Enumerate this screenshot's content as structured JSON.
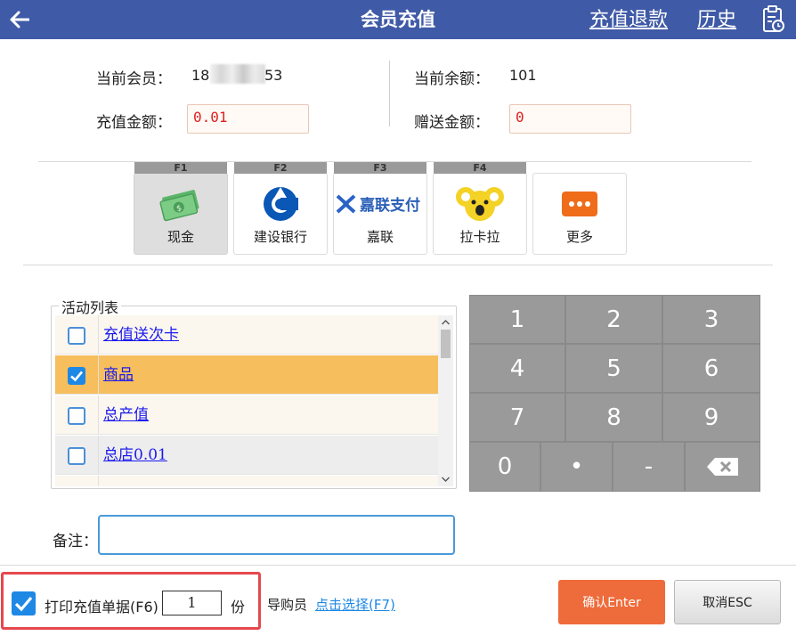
{
  "header": {
    "title": "会员充值",
    "refund_link": "充值退款",
    "history_link": "历史",
    "bg_color": "#3f5aa6"
  },
  "member": {
    "current_member_label": "当前会员：",
    "phone_prefix": "18",
    "phone_suffix": "53",
    "balance_label": "当前余额：",
    "balance_value": "101",
    "recharge_label": "充值金额：",
    "recharge_value": "0.01",
    "gift_label": "赠送金额：",
    "gift_value": "0"
  },
  "payments": [
    {
      "key": "F1",
      "label": "现金",
      "icon": "cash-icon",
      "active": true
    },
    {
      "key": "F2",
      "label": "建设银行",
      "icon": "ccb-logo-icon",
      "active": false
    },
    {
      "key": "F3",
      "label": "嘉联",
      "icon": "jialian-pay-logo-icon",
      "logo_text": "嘉联支付",
      "active": false
    },
    {
      "key": "F4",
      "label": "拉卡拉",
      "icon": "lakala-koala-icon",
      "active": false
    },
    {
      "key": "",
      "label": "更多",
      "icon": "more-icon",
      "active": false
    }
  ],
  "activities": {
    "legend": "活动列表",
    "items": [
      {
        "name": "充值送次卡",
        "checked": false
      },
      {
        "name": "商品",
        "checked": true
      },
      {
        "name": "总产值",
        "checked": false
      },
      {
        "name": "总店0.01",
        "checked": false
      }
    ],
    "selected_color": "#f6be5d"
  },
  "keypad": {
    "rows": [
      [
        "1",
        "2",
        "3"
      ],
      [
        "4",
        "5",
        "6"
      ],
      [
        "7",
        "8",
        "9"
      ]
    ],
    "bottom": [
      "0",
      "•",
      "-"
    ],
    "backspace_icon": "backspace-icon"
  },
  "remark": {
    "label": "备注：",
    "value": ""
  },
  "footer": {
    "print_label": "打印充值单据(F6)",
    "print_checked": true,
    "copies": "1",
    "copies_unit": "份",
    "guide_label": "导购员",
    "guide_select": "点击选择(F7)",
    "confirm": "确认Enter",
    "cancel": "取消ESC",
    "confirm_color": "#ee6b3b",
    "highlight_color": "#e5484d"
  }
}
